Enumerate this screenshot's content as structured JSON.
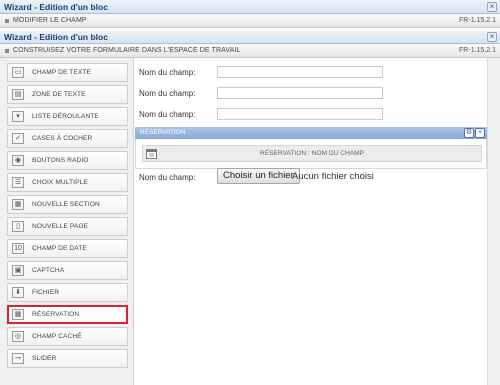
{
  "window1": {
    "title": "Wizard - Edition d'un bloc",
    "close": "×",
    "subtitle": "MODIFIER LE CHAMP",
    "version": "FR-1.15.2.1"
  },
  "window2": {
    "title": "Wizard - Edition d'un bloc",
    "close": "×",
    "subtitle": "CONSTRUISEZ VOTRE FORMULAIRE DANS L'ESPACE DE TRAVAIL",
    "version": "FR-1.15.2.1"
  },
  "tools": [
    {
      "label": "CHAMP DE TEXTE",
      "icon": "text-field-icon",
      "glyph": "▭"
    },
    {
      "label": "ZONE DE TEXTE",
      "icon": "textarea-icon",
      "glyph": "▤"
    },
    {
      "label": "LISTE DÉROULANTE",
      "icon": "dropdown-icon",
      "glyph": "▾"
    },
    {
      "label": "CASES À COCHER",
      "icon": "checkbox-icon",
      "glyph": "✓"
    },
    {
      "label": "BOUTONS RADIO",
      "icon": "radio-icon",
      "glyph": "◉"
    },
    {
      "label": "CHOIX MULTIPLE",
      "icon": "multi-choice-icon",
      "glyph": "☰"
    },
    {
      "label": "NOUVELLE SECTION",
      "icon": "section-icon",
      "glyph": "▦"
    },
    {
      "label": "NOUVELLE PAGE",
      "icon": "page-icon",
      "glyph": "▯"
    },
    {
      "label": "CHAMP DE DATE",
      "icon": "date-icon",
      "glyph": "10"
    },
    {
      "label": "CAPTCHA",
      "icon": "captcha-icon",
      "glyph": "▣"
    },
    {
      "label": "FICHIER",
      "icon": "upload-icon",
      "glyph": "⬇"
    },
    {
      "label": "RÉSERVATION",
      "icon": "calendar-icon",
      "glyph": "▦",
      "selected": true
    },
    {
      "label": "CHAMP CACHÉ",
      "icon": "hidden-eye-icon",
      "glyph": "◎"
    },
    {
      "label": "SLIDER",
      "icon": "slider-icon",
      "glyph": "⊸"
    }
  ],
  "fields": [
    {
      "label": "Nom du champ:",
      "value": ""
    },
    {
      "label": "Nom du champ:",
      "value": ""
    },
    {
      "label": "Nom du champ:",
      "value": ""
    }
  ],
  "reservation": {
    "title": "RÉSERVATION",
    "edit": "⚙",
    "close": "×",
    "placeholder": "RÉSERVATION : NOM DU CHAMP"
  },
  "file_field": {
    "label": "Nom du champ:",
    "button": "Choisir un fichier",
    "status": "Aucun fichier choisi"
  }
}
